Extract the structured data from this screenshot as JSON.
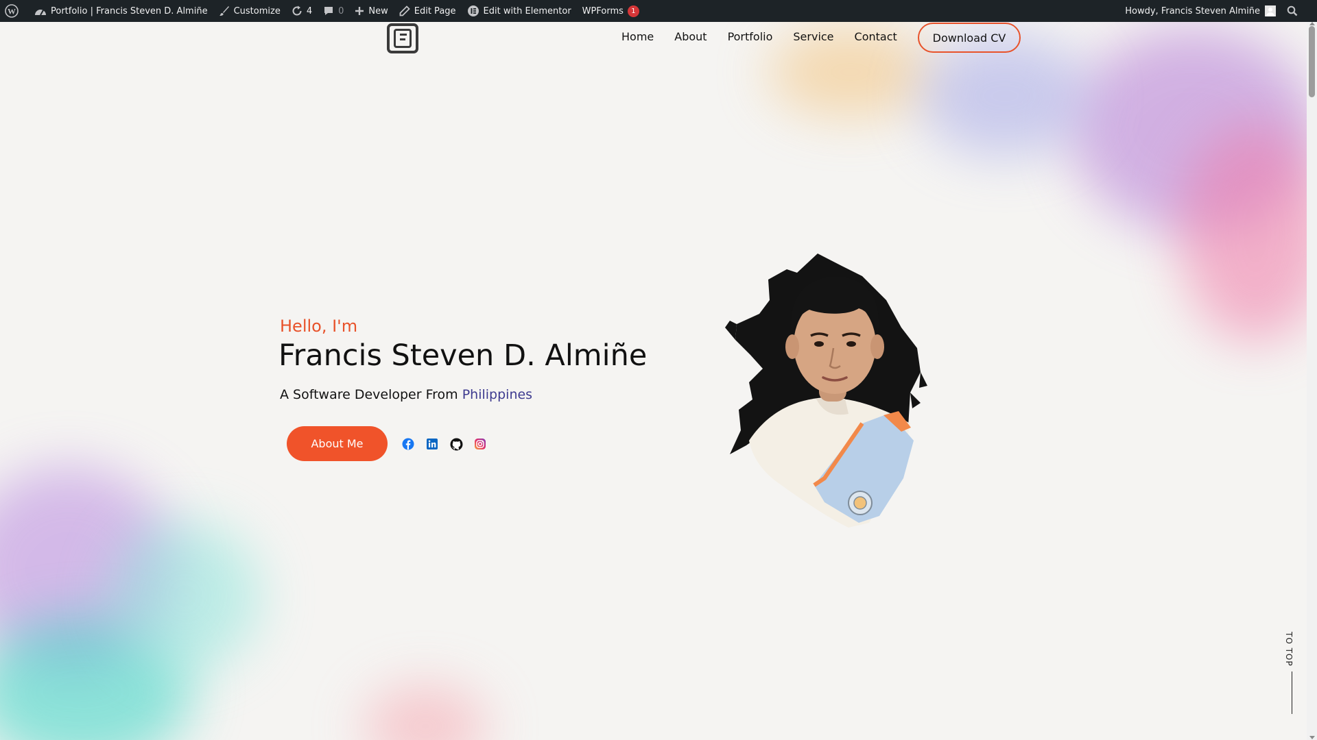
{
  "adminbar": {
    "site_title": "Portfolio | Francis Steven D. Almiñe",
    "customize": "Customize",
    "updates_count": "4",
    "comments_count": "0",
    "new": "New",
    "edit_page": "Edit Page",
    "edit_elementor": "Edit with Elementor",
    "wpforms": "WPForms",
    "wpforms_badge": "1",
    "howdy": "Howdy, Francis Steven Almiñe"
  },
  "nav": {
    "items": [
      "Home",
      "About",
      "Portfolio",
      "Service",
      "Contact"
    ],
    "cta": "Download CV"
  },
  "hero": {
    "greeting": "Hello, I'm",
    "name": "Francis Steven D. Almiñe",
    "tagline_prefix": "A Software Developer From",
    "tagline_highlight": "Philippines",
    "button": "About Me",
    "socials": [
      "facebook-icon",
      "linkedin-icon",
      "github-icon",
      "instagram-icon"
    ]
  },
  "to_top": "TO TOP",
  "colors": {
    "accent": "#f0532a",
    "highlight": "#3d3a8f",
    "adminbar_bg": "#1d2327",
    "page_bg": "#f5f4f2"
  }
}
